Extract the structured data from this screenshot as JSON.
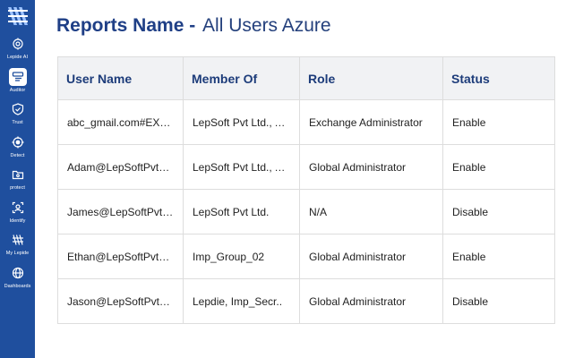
{
  "sidebar": {
    "logo_icon": "lepide-logo-icon",
    "items": [
      {
        "label": "Lepide AI",
        "icon": "ai-icon",
        "active": false
      },
      {
        "label": "Auditor",
        "icon": "auditor-icon",
        "active": true
      },
      {
        "label": "Trust",
        "icon": "trust-icon",
        "active": false
      },
      {
        "label": "Detect",
        "icon": "detect-icon",
        "active": false
      },
      {
        "label": "protect",
        "icon": "protect-icon",
        "active": false
      },
      {
        "label": "Identify",
        "icon": "identify-icon",
        "active": false
      },
      {
        "label": "My Lepide",
        "icon": "my-lepide-icon",
        "active": false
      },
      {
        "label": "Dashboards",
        "icon": "dashboards-icon",
        "active": false
      }
    ]
  },
  "header": {
    "title": "Reports Name -",
    "subtitle": "All Users Azure"
  },
  "table": {
    "columns": [
      "User Name",
      "Member Of",
      "Role",
      "Status"
    ],
    "rows": [
      {
        "user": "abc_gmail.com#EXT#@LepSoftPvtLtd.onmicrosoft.com",
        "member_of": "LepSoft Pvt Ltd., All Users",
        "role": "Exchange Administrator",
        "status": "Enable"
      },
      {
        "user": "Adam@LepSoftPvtLtd.onmicrosoft.com",
        "member_of": "LepSoft Pvt Ltd., All Users",
        "role": "Global Administrator",
        "status": "Enable"
      },
      {
        "user": "James@LepSoftPvtLtd.onmicrosoft.com",
        "member_of": "LepSoft Pvt Ltd.",
        "role": "N/A",
        "status": "Disable"
      },
      {
        "user": "Ethan@LepSoftPvtLtd.onmicrosoft.com",
        "member_of": "Imp_Group_02",
        "role": "Global Administrator",
        "status": "Enable"
      },
      {
        "user": "Jason@LepSoftPvtLtd.onmicrosoft.com",
        "member_of": "Lepdie, Imp_Secr..",
        "role": "Global Administrator",
        "status": "Disable"
      }
    ]
  },
  "colors": {
    "sidebar_bg": "#1f4f9e",
    "title": "#1f3f86",
    "header_bg": "#f1f2f4"
  }
}
